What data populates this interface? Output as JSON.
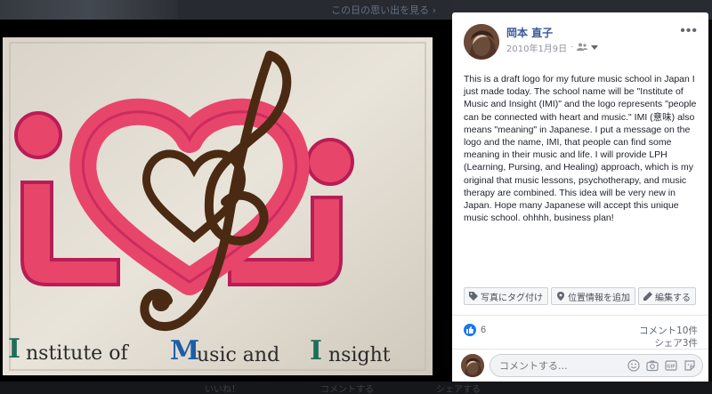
{
  "background": {
    "memory_link": "この日の思い出を見る ›",
    "bottom_items": [
      "いいね！",
      "コメントする",
      "シェアする"
    ]
  },
  "post": {
    "author": "岡本 直子",
    "date": "2010年1月9日",
    "privacy_icon": "friends-icon",
    "more_label": "•••",
    "caption": "This is a draft logo for my future music school in Japan I just made today. The school name will be \"Institute of Music and Insight (IMI)\" and the logo represents \"people can be connected with heart and music.\" IMI (意味) also means \"meaning\" in Japanese. I put a message on the logo and the name, IMI, that people can find some meaning in their music and life. I will provide LPH (Learning, Pursing, and Healing) approach, which is my original that music lessons, psychotherapy, and music therapy are combined. This idea will be very new in Japan. Hope many Japanese will accept this unique music school. ohhhh, business plan!",
    "actions": {
      "tag": "写真にタグ付け",
      "location": "位置情報を追加",
      "edit": "編集する"
    },
    "likes": "6",
    "comments": "コメント10件",
    "shares": "シェア3件",
    "comment_placeholder": "コメントする..."
  },
  "photo": {
    "logo_text": {
      "part1": "I",
      "part2": "nstitute of ",
      "part3": "M",
      "part4": "usic and ",
      "part5": "I",
      "part6": "nsight"
    }
  },
  "colors": {
    "link": "#385898",
    "like": "#1877f2",
    "heart": "#e8456b",
    "clef": "#4a2a12"
  }
}
